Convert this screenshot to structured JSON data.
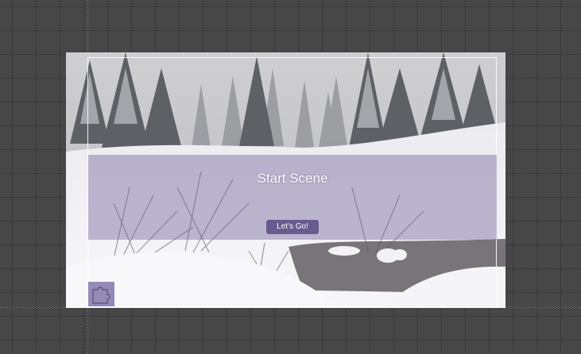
{
  "panel": {
    "title": "Start Scene",
    "button_label": "Let's Go!"
  },
  "icons": {
    "corner_badge": "puzzle-piece-icon"
  },
  "colors": {
    "editor_background": "#474747",
    "panel_overlay": "#6e5f96",
    "button_background": "#5a4b82",
    "text": "#ffffff"
  }
}
